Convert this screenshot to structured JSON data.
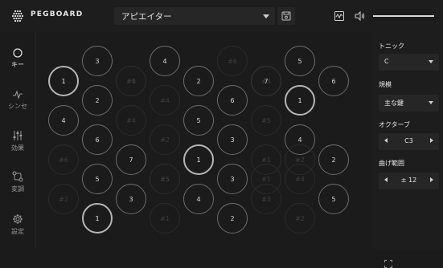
{
  "app": {
    "brand": "PEGBOARD"
  },
  "header": {
    "instrument": "アピエイター"
  },
  "sidebar": {
    "items": [
      {
        "label": "キー",
        "icon": "circle-icon",
        "active": true
      },
      {
        "label": "シンセ",
        "icon": "waveform-icon",
        "active": false
      },
      {
        "label": "効果",
        "icon": "sliders-icon",
        "active": false
      },
      {
        "label": "変調",
        "icon": "routing-icon",
        "active": false
      },
      {
        "label": "設定",
        "icon": "gear-icon",
        "active": false
      }
    ]
  },
  "panel": {
    "tonic_label": "トニック",
    "tonic_value": "C",
    "scale_label": "規模",
    "scale_value": "主な鍵",
    "octave_label": "オクターブ",
    "octave_value": "C3",
    "bend_label": "曲げ範囲",
    "bend_value": "± 12"
  },
  "pads": [
    {
      "label": "1",
      "state": "root"
    },
    {
      "label": "3",
      "state": "on"
    },
    {
      "label": "4",
      "state": "on"
    },
    {
      "label": "#1",
      "state": "dim"
    },
    {
      "label": "2",
      "state": "on"
    },
    {
      "label": "#4",
      "state": "dim"
    },
    {
      "label": "6",
      "state": "on"
    },
    {
      "label": "#6",
      "state": "dim"
    },
    {
      "label": "7",
      "state": "on"
    },
    {
      "label": "#2",
      "state": "dim"
    },
    {
      "label": "1",
      "state": "root"
    },
    {
      "label": "5",
      "state": "on"
    },
    {
      "label": "3",
      "state": "on"
    },
    {
      "label": "4",
      "state": "on"
    },
    {
      "label": "#4",
      "state": "dim"
    },
    {
      "label": "5",
      "state": "on"
    },
    {
      "label": "#5",
      "state": "dim"
    },
    {
      "label": "6",
      "state": "on"
    },
    {
      "label": "2",
      "state": "on"
    },
    {
      "label": "#2",
      "state": "dim"
    },
    {
      "label": "3",
      "state": "on"
    },
    {
      "label": "4",
      "state": "on"
    },
    {
      "label": "#6",
      "state": "dim"
    },
    {
      "label": "7",
      "state": "on"
    },
    {
      "label": "1",
      "state": "root"
    },
    {
      "label": "#1",
      "state": "dim"
    },
    {
      "label": "2",
      "state": "on"
    },
    {
      "label": "5",
      "state": "on"
    },
    {
      "label": "#5",
      "state": "dim"
    },
    {
      "label": "6",
      "state": "on"
    },
    {
      "label": "#3",
      "state": "dim"
    },
    {
      "label": "#2",
      "state": "dim"
    },
    {
      "label": "3",
      "state": "on"
    },
    {
      "label": "4",
      "state": "on"
    },
    {
      "label": "#4",
      "state": "dim"
    },
    {
      "label": "5",
      "state": "on"
    },
    {
      "label": "1",
      "state": "root"
    },
    {
      "label": "#1",
      "state": "dim"
    },
    {
      "label": "2",
      "state": "on"
    },
    {
      "label": "#2",
      "state": "dim"
    },
    {
      "label": "#3",
      "state": "dim"
    },
    {
      "label": "#6",
      "state": "dim"
    },
    {
      "label": "#5",
      "state": "dim"
    },
    {
      "label": "#1",
      "state": "dim"
    }
  ]
}
